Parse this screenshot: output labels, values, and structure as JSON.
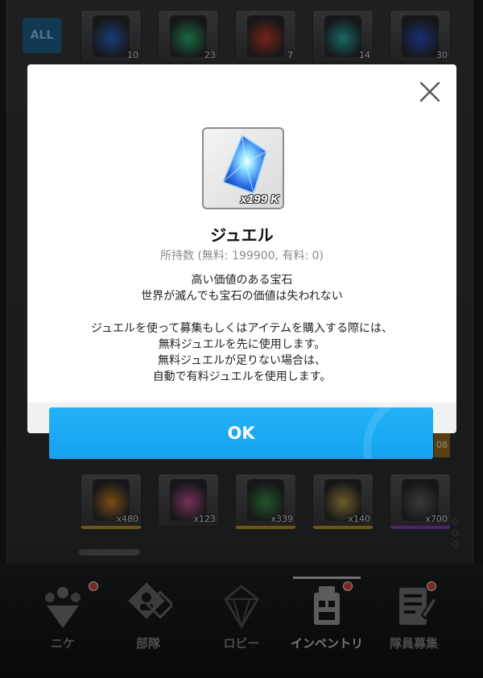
{
  "inventory": {
    "filter_all_label": "ALL",
    "top_row": [
      {
        "icon": "blue-core-canister-icon",
        "count": "10",
        "tint": "#2f6fd6"
      },
      {
        "icon": "green-core-canister-icon",
        "count": "23",
        "tint": "#2fbf7a"
      },
      {
        "icon": "red-core-canister-icon",
        "count": "7",
        "tint": "#d8432d"
      },
      {
        "icon": "teal-core-canister-icon",
        "count": "14",
        "tint": "#2fbfb6"
      },
      {
        "icon": "blue-star-canister-icon",
        "count": "30",
        "tint": "#2c54d6"
      }
    ],
    "bottom_row": [
      {
        "icon": "battery-pack-icon",
        "count": "x480",
        "tint": "#d98a2a"
      },
      {
        "icon": "hand-buffer-icon",
        "count": "x123",
        "tint": "#d25aa0"
      },
      {
        "icon": "toolbox-icon",
        "count": "x339",
        "tint": "#3f9a4c"
      },
      {
        "icon": "id-card-gold-icon",
        "count": "x140",
        "tint": "#c9a94e"
      },
      {
        "icon": "id-card-purple-icon",
        "count": "x700",
        "tint": "#6a6a6a"
      }
    ],
    "side_count": "08"
  },
  "modal": {
    "close_icon": "close-icon",
    "item_icon": "jewel-crystal-icon",
    "item_quantity": "x199 K",
    "item_name": "ジュエル",
    "owned_text": "所持数 (無料: 199900, 有料: 0)",
    "description_lines": [
      "高い価値のある宝石",
      "世界が滅んでも宝石の価値は失われない"
    ],
    "note_lines": [
      "ジュエルを使って募集もしくはアイテムを購入する際には、",
      "無料ジュエルを先に使用します。",
      "無料ジュエルが足りない場合は、",
      "自動で有料ジュエルを使用します。"
    ],
    "ok_label": "OK"
  },
  "nav": {
    "items": [
      {
        "label": "ニケ",
        "icon": "nikke-icon",
        "badge": true
      },
      {
        "label": "部隊",
        "icon": "squad-icon",
        "badge": false
      },
      {
        "label": "ロビー",
        "icon": "lobby-icon",
        "badge": false
      },
      {
        "label": "インベントリ",
        "icon": "inventory-icon",
        "badge": true,
        "active": true
      },
      {
        "label": "隊員募集",
        "icon": "recruit-icon",
        "badge": true
      }
    ]
  },
  "colors": {
    "accent": "#14a3f0",
    "badge": "#e14b3a",
    "modal_bg": "#ffffff"
  }
}
